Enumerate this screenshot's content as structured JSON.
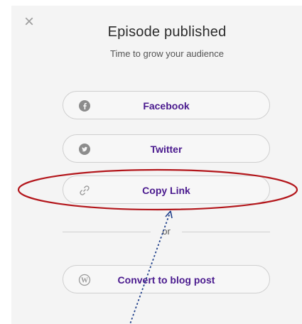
{
  "dialog": {
    "title": "Episode published",
    "subtitle": "Time to grow your audience",
    "close_icon": "close-icon"
  },
  "share_buttons": [
    {
      "label": "Facebook",
      "icon": "facebook-icon"
    },
    {
      "label": "Twitter",
      "icon": "twitter-icon"
    },
    {
      "label": "Copy Link",
      "icon": "link-icon"
    }
  ],
  "divider_label": "or",
  "blog_button": {
    "label": "Convert to blog post",
    "icon": "wordpress-icon"
  },
  "colors": {
    "accent": "#4a1a8e",
    "annotation_ellipse": "#b3161b",
    "annotation_arrow": "#1f3f8a"
  }
}
